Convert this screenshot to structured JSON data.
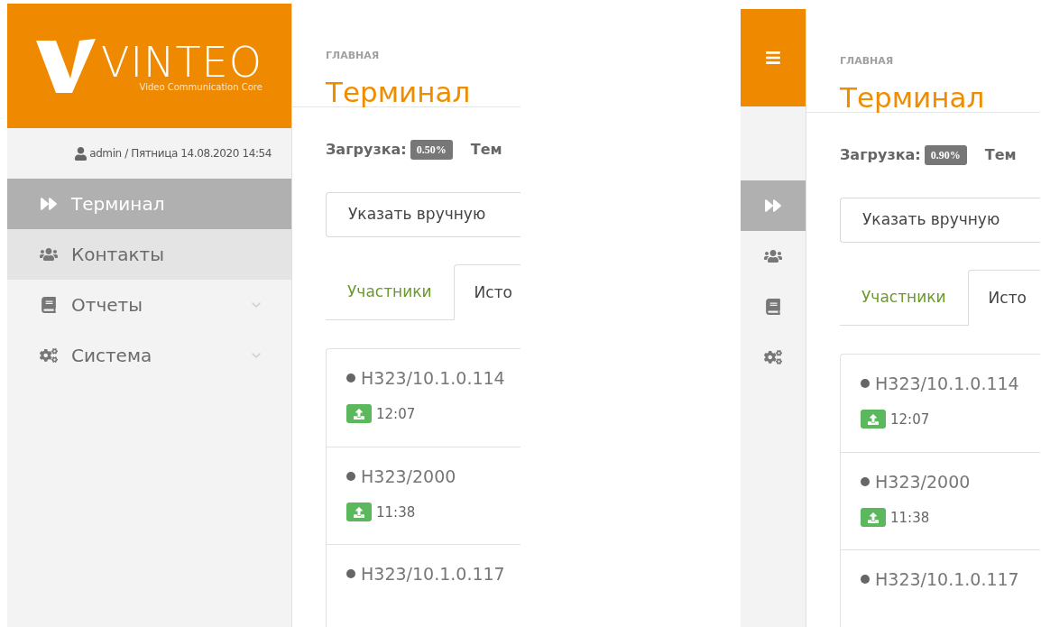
{
  "views": [
    {
      "kind": "expanded",
      "logo": {
        "brand": "VINTEO",
        "tagline": "Video Communication Core"
      },
      "user_line": "admin / Пятница 14.08.2020 14:54",
      "menu": [
        {
          "kind": "forward",
          "label": "Терминал",
          "selected": true,
          "highlighted": false,
          "expandable": false
        },
        {
          "kind": "users",
          "label": "Контакты",
          "selected": false,
          "highlighted": true,
          "expandable": false
        },
        {
          "kind": "book",
          "label": "Отчеты",
          "selected": false,
          "highlighted": false,
          "expandable": true
        },
        {
          "kind": "gears",
          "label": "Система",
          "selected": false,
          "highlighted": false,
          "expandable": true
        }
      ],
      "breadcrumb": "ГЛАВНАЯ",
      "title": "Терминал",
      "load_label": "Загрузка:",
      "load_value": "0.50%",
      "next_label": "Тем",
      "select_value": "Указать вручную",
      "tabs": [
        {
          "label": "Участники",
          "selected": false
        },
        {
          "label": "Исто",
          "selected": true
        }
      ],
      "calls": [
        {
          "address": "H323/10.1.0.114",
          "time": "12:07"
        },
        {
          "address": "H323/2000",
          "time": "11:38"
        },
        {
          "address": "H323/10.1.0.117"
        }
      ]
    },
    {
      "kind": "collapsed",
      "menu": [
        {
          "kind": "forward",
          "selected": true
        },
        {
          "kind": "users",
          "selected": false
        },
        {
          "kind": "book",
          "selected": false
        },
        {
          "kind": "gears",
          "selected": false
        }
      ],
      "breadcrumb": "ГЛАВНАЯ",
      "title": "Терминал",
      "load_label": "Загрузка:",
      "load_value": "0.90%",
      "next_label": "Тем",
      "select_value": "Указать вручную",
      "tabs": [
        {
          "label": "Участники",
          "selected": false
        },
        {
          "label": "Исто",
          "selected": true
        }
      ],
      "calls": [
        {
          "address": "H323/10.1.0.114",
          "time": "12:07"
        },
        {
          "address": "H323/2000",
          "time": "11:38"
        },
        {
          "address": "H323/10.1.0.117"
        }
      ]
    }
  ]
}
